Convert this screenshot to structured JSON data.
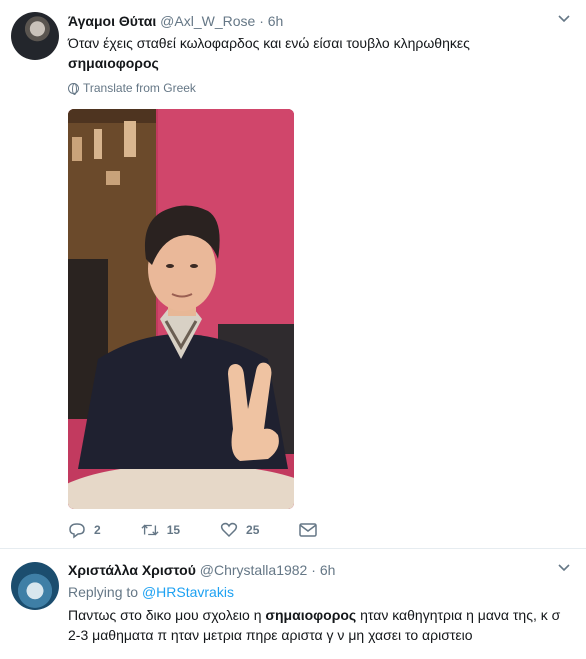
{
  "tweets": [
    {
      "name": "Άγαμοι Θύται",
      "handle": "@Axl_W_Rose",
      "time": "6h",
      "text_plain": "Όταν έχεις σταθεί κωλοφαρδος και ενώ είσαι τουβλο κληρωθηκες",
      "text_bold": "σημαιοφορος",
      "translate_label": "Translate from Greek",
      "actions": {
        "reply_count": "2",
        "retweet_count": "15",
        "like_count": "25"
      }
    },
    {
      "name": "Χριστάλλα Χριστού",
      "handle": "@Chrystalla1982",
      "time": "6h",
      "replying_to_label": "Replying to",
      "replying_to_handle": "@HRStavrakis",
      "text_before": "Παντως στο δικο μου σχολειο η ",
      "text_bold": "σημαιοφορος",
      "text_after": " ηταν καθηγητρια η μανα της, κ σ 2-3 μαθηματα π ηταν μετρια πηρε αριστα γ ν μη χασει το αριστειο"
    }
  ],
  "icons": {
    "more": "chevron-down-icon",
    "translate": "globe-icon",
    "reply": "reply-icon",
    "retweet": "retweet-icon",
    "like": "heart-icon",
    "dm": "envelope-icon"
  },
  "colors": {
    "text": "#14171a",
    "secondary": "#657786",
    "link": "#1da1f2",
    "divider": "#e6ecf0"
  }
}
